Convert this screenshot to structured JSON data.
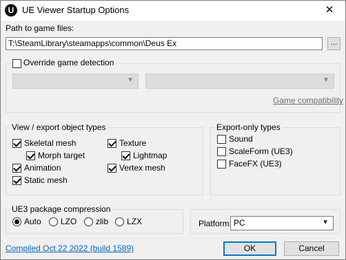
{
  "window": {
    "title": "UE Viewer Startup Options",
    "app_icon": "U",
    "close_glyph": "✕"
  },
  "path": {
    "label": "Path to game files:",
    "value": "T:\\SteamLibrary\\steamapps\\common\\Deus Ex",
    "browse_label": "..."
  },
  "game_detection": {
    "override_label": "Override game detection",
    "override_checked": false,
    "game_select": "",
    "engine_select": "",
    "compatibility_link": "Game compatibility"
  },
  "object_types": {
    "title": "View / export object types",
    "items": [
      {
        "label": "Skeletal mesh",
        "checked": true
      },
      {
        "label": "Morph target",
        "checked": true
      },
      {
        "label": "Animation",
        "checked": true
      },
      {
        "label": "Static mesh",
        "checked": true
      },
      {
        "label": "Texture",
        "checked": true
      },
      {
        "label": "Lightmap",
        "checked": true
      },
      {
        "label": "Vertex mesh",
        "checked": true
      }
    ]
  },
  "export_only": {
    "title": "Export-only types",
    "items": [
      {
        "label": "Sound",
        "checked": false
      },
      {
        "label": "ScaleForm (UE3)",
        "checked": false
      },
      {
        "label": "FaceFX (UE3)",
        "checked": false
      }
    ]
  },
  "compression": {
    "title": "UE3 package compression",
    "options": [
      {
        "label": "Auto",
        "selected": true
      },
      {
        "label": "LZO",
        "selected": false
      },
      {
        "label": "zlib",
        "selected": false
      },
      {
        "label": "LZX",
        "selected": false
      }
    ]
  },
  "platform": {
    "label": "Platform:",
    "value": "PC"
  },
  "footer": {
    "build_link": "Compiled Oct 22 2022 (build 1589)",
    "ok_label": "OK",
    "cancel_label": "Cancel"
  }
}
